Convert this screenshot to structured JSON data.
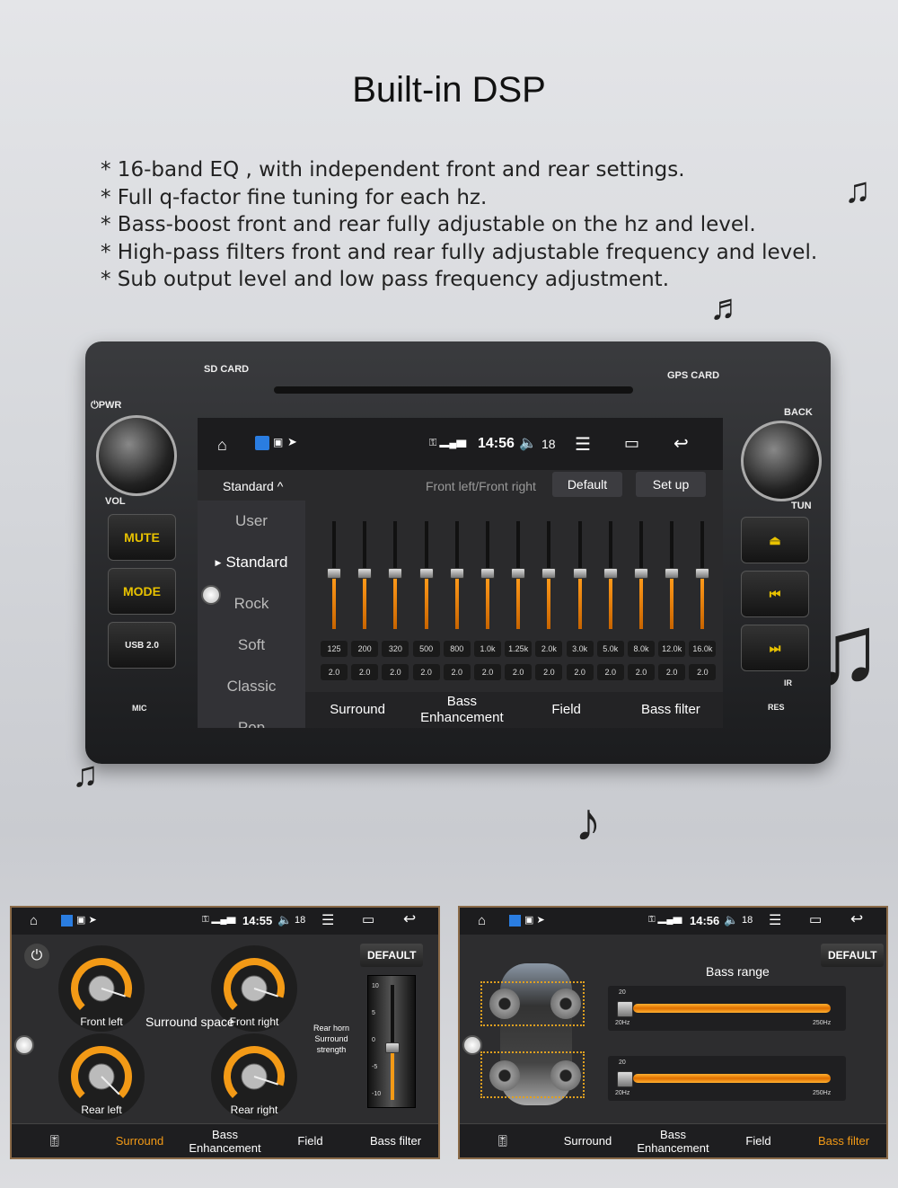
{
  "title": "Built-in DSP",
  "bullets": [
    "* 16-band EQ , with independent front and rear settings.",
    "* Full q-factor fine tuning for each hz.",
    "* Bass-boost front and rear fully adjustable on the hz and level.",
    "* High-pass filters front and rear fully adjustable frequency and level.",
    "* Sub output level and  low pass frequency adjustment."
  ],
  "unit": {
    "sd_card": "SD CARD",
    "gps_card": "GPS CARD",
    "pwr": "⏻PWR",
    "vol": "VOL",
    "back": "BACK",
    "tun": "TUN",
    "mic": "MIC",
    "ir": "IR",
    "res": "RES",
    "buttons": {
      "mute": "MUTE",
      "mode": "MODE",
      "usb": "USB 2.0"
    }
  },
  "main_screen": {
    "time": "14:56",
    "volume": "18",
    "preset": "Standard ^",
    "channel": "Front left/Front right",
    "default": "Default",
    "setup": "Set up",
    "presets": [
      "User",
      "Standard",
      "Rock",
      "Soft",
      "Classic",
      "Pop"
    ],
    "selected_preset": "Standard",
    "frequencies": [
      "125",
      "200",
      "320",
      "500",
      "800",
      "1.0k",
      "1.25k",
      "2.0k",
      "3.0k",
      "5.0k",
      "8.0k",
      "12.0k",
      "16.0k"
    ],
    "q_values": [
      "2.0",
      "2.0",
      "2.0",
      "2.0",
      "2.0",
      "2.0",
      "2.0",
      "2.0",
      "2.0",
      "2.0",
      "2.0",
      "2.0",
      "2.0"
    ],
    "tabs": [
      "Surround",
      "Bass Enhancement",
      "Field",
      "Bass filter"
    ]
  },
  "surround_panel": {
    "time": "14:55",
    "volume": "18",
    "default": "DEFAULT",
    "space_label": "Surround space",
    "knobs": [
      {
        "label": "Front left",
        "value": 90
      },
      {
        "label": "Front right",
        "value": 90
      },
      {
        "label": "Rear left",
        "value": 100
      },
      {
        "label": "Rear right",
        "value": 90
      }
    ],
    "rear_label": [
      "Rear horn",
      "Surround",
      "strength"
    ],
    "fader_scale": [
      "10",
      "5",
      "0",
      "-5",
      "-10"
    ],
    "fader_value": -1,
    "tabs": [
      "Surround",
      "Bass Enhancement",
      "Field",
      "Bass filter"
    ],
    "active_tab": "Surround"
  },
  "bass_panel": {
    "time": "14:56",
    "volume": "18",
    "default": "DEFAULT",
    "bass_range": "Bass range",
    "sliders": [
      {
        "value": "20",
        "min": "20Hz",
        "max": "250Hz"
      },
      {
        "value": "20",
        "min": "20Hz",
        "max": "250Hz"
      }
    ],
    "tabs": [
      "Surround",
      "Bass Enhancement",
      "Field",
      "Bass filter"
    ],
    "active_tab": "Bass filter"
  },
  "colors": {
    "accent": "#f39a16",
    "screen_bg": "#2a2a2c"
  }
}
